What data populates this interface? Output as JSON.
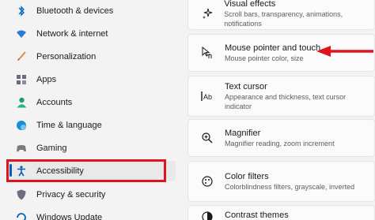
{
  "sidebar": {
    "items": [
      {
        "label": "Bluetooth & devices",
        "icon": "bluetooth-icon"
      },
      {
        "label": "Network & internet",
        "icon": "wifi-icon"
      },
      {
        "label": "Personalization",
        "icon": "brush-icon"
      },
      {
        "label": "Apps",
        "icon": "apps-icon"
      },
      {
        "label": "Accounts",
        "icon": "person-icon"
      },
      {
        "label": "Time & language",
        "icon": "globe-clock-icon"
      },
      {
        "label": "Gaming",
        "icon": "gamepad-icon"
      },
      {
        "label": "Accessibility",
        "icon": "accessibility-icon"
      },
      {
        "label": "Privacy & security",
        "icon": "shield-icon"
      },
      {
        "label": "Windows Update",
        "icon": "update-icon"
      }
    ],
    "selected": "Accessibility"
  },
  "main": {
    "cards": [
      {
        "title": "Visual effects",
        "subtitle": "Scroll bars, transparency, animations, notifications",
        "icon": "sparkle-icon"
      },
      {
        "title": "Mouse pointer and touch",
        "subtitle": "Mouse pointer color, size",
        "icon": "mouse-pointer-icon"
      },
      {
        "title": "Text cursor",
        "subtitle": "Appearance and thickness, text cursor indicator",
        "icon": "text-cursor-icon"
      },
      {
        "title": "Magnifier",
        "subtitle": "Magnifier reading, zoom increment",
        "icon": "magnifier-icon"
      },
      {
        "title": "Color filters",
        "subtitle": "Colorblindness filters, grayscale, inverted",
        "icon": "color-filter-icon"
      },
      {
        "title": "Contrast themes",
        "subtitle": "",
        "icon": "contrast-icon"
      }
    ]
  },
  "colors": {
    "accent": "#005fb8",
    "highlight": "#e0141e"
  }
}
